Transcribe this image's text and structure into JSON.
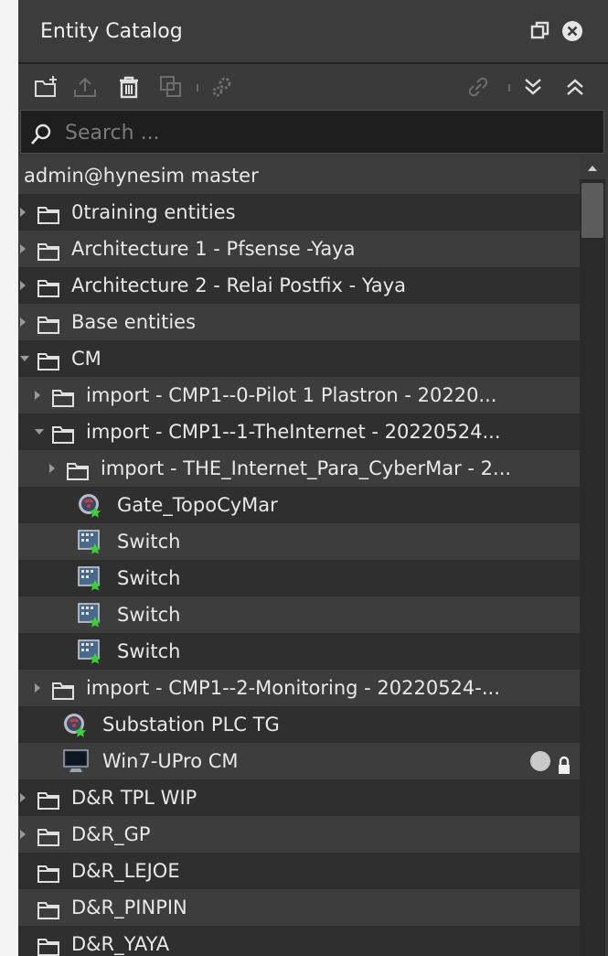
{
  "panel": {
    "title": "Entity Catalog"
  },
  "search": {
    "placeholder": "Search ..."
  },
  "toolbar": {
    "icons": [
      "new-folder-icon",
      "upload-icon",
      "trash-icon",
      "duplicate-icon",
      "settings-gear-icon",
      "link-icon",
      "expand-all-icon",
      "collapse-all-icon"
    ]
  },
  "tree": {
    "root_label": "admin@hynesim master",
    "items": [
      {
        "label": "0training entities",
        "type": "folder",
        "depth": 0,
        "caret": "right"
      },
      {
        "label": "Architecture 1 - Pfsense -Yaya",
        "type": "folder",
        "depth": 0,
        "caret": "right"
      },
      {
        "label": "Architecture 2 - Relai Postfix - Yaya",
        "type": "folder",
        "depth": 0,
        "caret": "right"
      },
      {
        "label": "Base entities",
        "type": "folder",
        "depth": 0,
        "caret": "right"
      },
      {
        "label": "CM",
        "type": "folder",
        "depth": 0,
        "caret": "down"
      },
      {
        "label": "import - CMP1--0-Pilot 1 Plastron - 20220...",
        "type": "folder",
        "depth": 1,
        "caret": "right"
      },
      {
        "label": "import - CMP1--1-TheInternet - 20220524...",
        "type": "folder",
        "depth": 1,
        "caret": "down"
      },
      {
        "label": "import - THE_Internet_Para_CyberMar - 2...",
        "type": "folder",
        "depth": 2,
        "caret": "right"
      },
      {
        "label": "Gate_TopoCyMar",
        "type": "router",
        "depth": 3,
        "caret": "none"
      },
      {
        "label": "Switch",
        "type": "switch",
        "depth": 3,
        "caret": "none"
      },
      {
        "label": "Switch",
        "type": "switch",
        "depth": 3,
        "caret": "none"
      },
      {
        "label": "Switch",
        "type": "switch",
        "depth": 3,
        "caret": "none"
      },
      {
        "label": "Switch",
        "type": "switch",
        "depth": 3,
        "caret": "none"
      },
      {
        "label": "import - CMP1--2-Monitoring - 20220524-...",
        "type": "folder",
        "depth": 1,
        "caret": "right"
      },
      {
        "label": "Substation PLC TG",
        "type": "router",
        "depth": 2,
        "caret": "none"
      },
      {
        "label": "Win7-UPro CM",
        "type": "computer",
        "depth": 2,
        "caret": "none",
        "status": true,
        "locked": true
      },
      {
        "label": "D&R TPL WIP",
        "type": "folder",
        "depth": 0,
        "caret": "right"
      },
      {
        "label": "D&R_GP",
        "type": "folder",
        "depth": 0,
        "caret": "right"
      },
      {
        "label": "D&R_LEJOE",
        "type": "folder",
        "depth": 0,
        "caret": "none"
      },
      {
        "label": "D&R_PINPIN",
        "type": "folder",
        "depth": 0,
        "caret": "none"
      },
      {
        "label": "D&R_YAYA",
        "type": "folder",
        "depth": 0,
        "caret": "none"
      }
    ]
  },
  "colors": {
    "panel_bg": "#3a3a3a",
    "row_light": "#3d3d3d",
    "row_dark": "#2f2f2f",
    "text": "#e8e8e8",
    "accent_green": "#3ccf3c"
  }
}
